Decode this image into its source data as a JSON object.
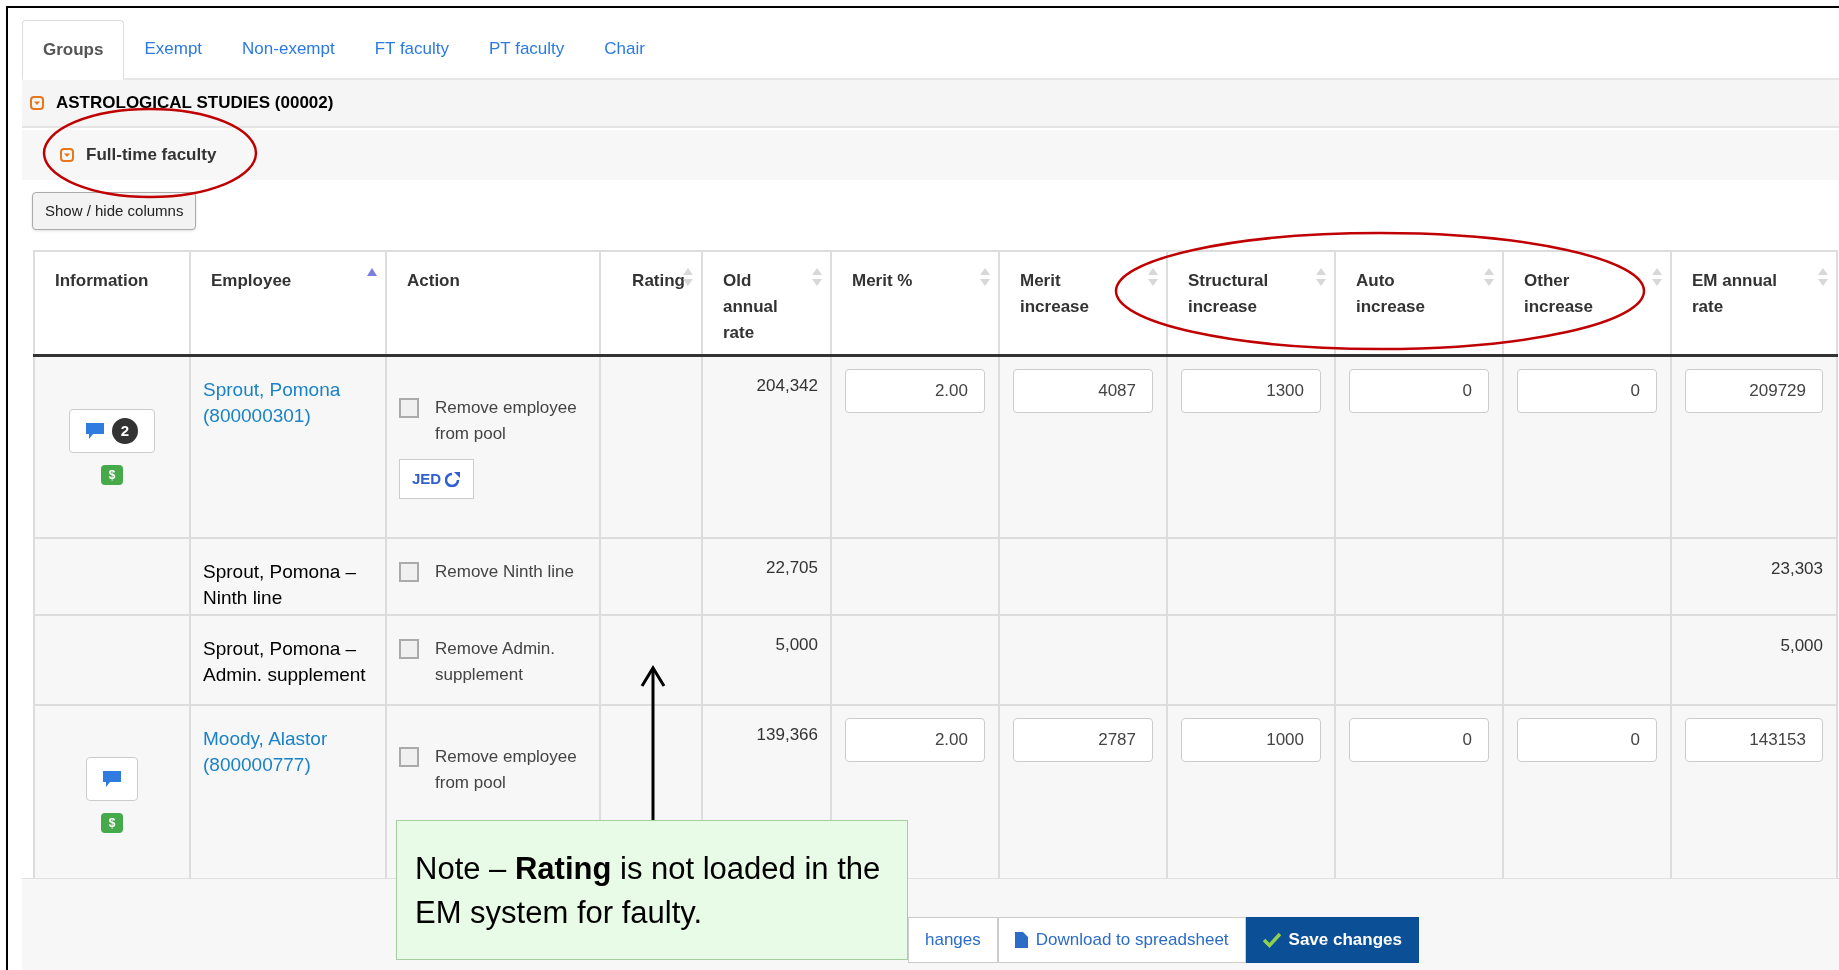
{
  "tabs": [
    {
      "label": "Groups",
      "selected": true
    },
    {
      "label": "Exempt",
      "selected": false
    },
    {
      "label": "Non-exempt",
      "selected": false
    },
    {
      "label": "FT faculty",
      "selected": false
    },
    {
      "label": "PT faculty",
      "selected": false
    },
    {
      "label": "Chair",
      "selected": false
    }
  ],
  "group": {
    "title": "ASTROLOGICAL STUDIES (00002)",
    "expanded": true
  },
  "subgroup": {
    "title": "Full-time faculty",
    "expanded": true
  },
  "show_hide_button": "Show / hide columns",
  "table": {
    "columns": [
      {
        "label": "Information",
        "sortable": false
      },
      {
        "label": "Employee",
        "sortable": true,
        "sorted": true
      },
      {
        "label": "Action",
        "sortable": false
      },
      {
        "label": "Rating",
        "sortable": true,
        "sorted": false
      },
      {
        "label": "Old annual rate",
        "sortable": true,
        "sorted": false
      },
      {
        "label": "Merit %",
        "sortable": true,
        "sorted": false
      },
      {
        "label": "Merit increase",
        "sortable": true,
        "sorted": false
      },
      {
        "label": "Structural increase",
        "sortable": true,
        "sorted": false
      },
      {
        "label": "Auto increase",
        "sortable": true,
        "sorted": false
      },
      {
        "label": "Other increase",
        "sortable": true,
        "sorted": false
      },
      {
        "label": "EM annual rate",
        "sortable": true,
        "sorted": false
      }
    ],
    "rows": [
      {
        "kind": "employee",
        "comments": "2",
        "money": "$",
        "employee": "Sprout, Pomona (800000301)",
        "action": {
          "label": "Remove employee from pool",
          "checked": false
        },
        "jed": "JED",
        "old_rate": "204,342",
        "fields": [
          "2.00",
          "4087",
          "1300",
          "0",
          "0",
          "209729"
        ]
      },
      {
        "kind": "line",
        "employee": "Sprout, Pomona – Ninth line",
        "action": {
          "label": "Remove Ninth line",
          "checked": false
        },
        "old_rate": "22,705",
        "em_rate": "23,303"
      },
      {
        "kind": "line",
        "employee": "Sprout, Pomona – Admin. supplement",
        "action": {
          "label": "Remove Admin. supplement",
          "checked": false
        },
        "old_rate": "5,000",
        "em_rate": "5,000"
      },
      {
        "kind": "employee",
        "money": "$",
        "employee": "Moody, Alastor (800000777)",
        "action": {
          "label": "Remove employee from pool",
          "checked": false
        },
        "old_rate": "139,366",
        "fields": [
          "2.00",
          "2787",
          "1000",
          "0",
          "0",
          "143153"
        ]
      }
    ]
  },
  "footer_buttons": [
    {
      "label": "hanges",
      "kind": "plain"
    },
    {
      "label": "Download to spreadsheet",
      "kind": "download"
    },
    {
      "label": "Save changes",
      "kind": "primary"
    }
  ],
  "note": "Note – **Rating** is not loaded in the EM system for faulty."
}
